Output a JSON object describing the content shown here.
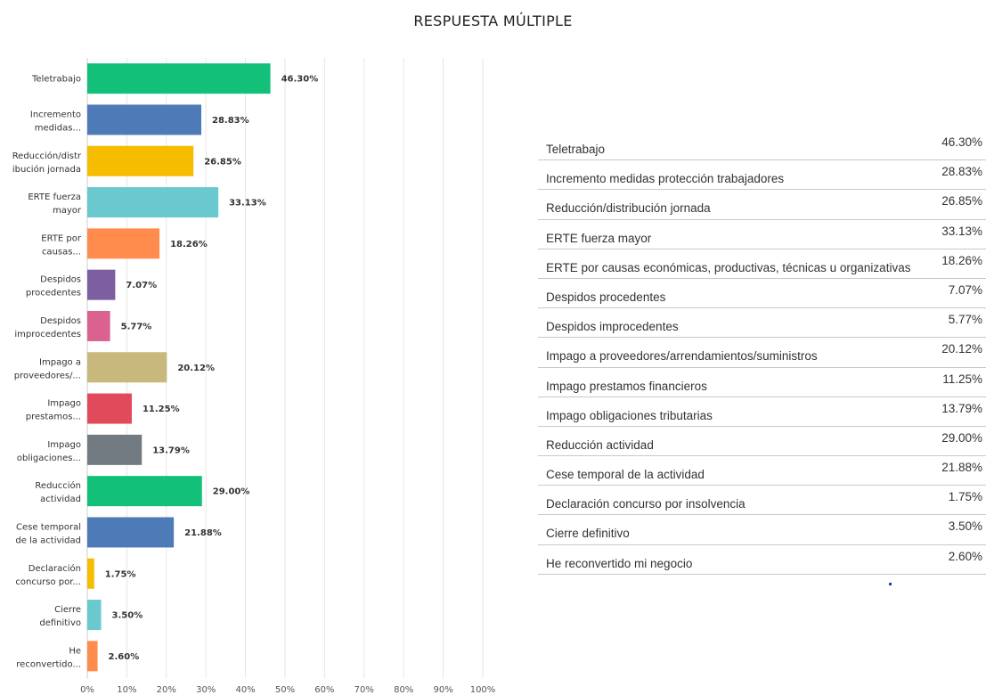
{
  "title": "RESPUESTA MÚLTIPLE",
  "chart_data": {
    "type": "bar",
    "orientation": "horizontal",
    "title": "RESPUESTA MÚLTIPLE",
    "xlim": [
      0,
      100
    ],
    "x_ticks": [
      "0%",
      "10%",
      "20%",
      "30%",
      "40%",
      "50%",
      "60%",
      "70%",
      "80%",
      "90%",
      "100%"
    ],
    "grid": true,
    "categories": [
      [
        "Teletrabajo"
      ],
      [
        "Incremento",
        "medidas..."
      ],
      [
        "Reducción/distr",
        "ibución jornada"
      ],
      [
        "ERTE fuerza",
        "mayor"
      ],
      [
        "ERTE por",
        "causas..."
      ],
      [
        "Despidos",
        "procedentes"
      ],
      [
        "Despidos",
        "improcedentes"
      ],
      [
        "Impago a",
        "proveedores/..."
      ],
      [
        "Impago",
        "prestamos..."
      ],
      [
        "Impago",
        "obligaciones..."
      ],
      [
        "Reducción",
        "actividad"
      ],
      [
        "Cese temporal",
        "de la actividad"
      ],
      [
        "Declaración",
        "concurso por..."
      ],
      [
        "Cierre",
        "definitivo"
      ],
      [
        "He",
        "reconvertido..."
      ]
    ],
    "values": [
      46.3,
      28.83,
      26.85,
      33.13,
      18.26,
      7.07,
      5.77,
      20.12,
      11.25,
      13.79,
      29.0,
      21.88,
      1.75,
      3.5,
      2.6
    ],
    "value_labels": [
      "46.30%",
      "28.83%",
      "26.85%",
      "33.13%",
      "18.26%",
      "7.07%",
      "5.77%",
      "20.12%",
      "11.25%",
      "13.79%",
      "29.00%",
      "21.88%",
      "1.75%",
      "3.50%",
      "2.60%"
    ],
    "colors": [
      "#12c07a",
      "#4f7ab8",
      "#f5bc00",
      "#6ac9cf",
      "#ff8c4d",
      "#7d5ea0",
      "#d9628f",
      "#c9b87c",
      "#e04a5a",
      "#737b82",
      "#12c07a",
      "#4f7ab8",
      "#f5bc00",
      "#6ac9cf",
      "#ff8c4d"
    ]
  },
  "table": {
    "rows": [
      {
        "label": "Teletrabajo",
        "value": "46.30%"
      },
      {
        "label": "Incremento medidas protección trabajadores",
        "value": "28.83%"
      },
      {
        "label": "Reducción/distribución jornada",
        "value": "26.85%"
      },
      {
        "label": "ERTE fuerza mayor",
        "value": "33.13%"
      },
      {
        "label": "ERTE por causas económicas, productivas, técnicas u organizativas",
        "value": "18.26%"
      },
      {
        "label": "Despidos procedentes",
        "value": "7.07%"
      },
      {
        "label": "Despidos improcedentes",
        "value": "5.77%"
      },
      {
        "label": "Impago a proveedores/arrendamientos/suministros",
        "value": "20.12%"
      },
      {
        "label": "Impago prestamos financieros",
        "value": "11.25%"
      },
      {
        "label": "Impago obligaciones tributarias",
        "value": "13.79%"
      },
      {
        "label": "Reducción actividad",
        "value": "29.00%"
      },
      {
        "label": "Cese temporal de la actividad",
        "value": "21.88%"
      },
      {
        "label": "Declaración concurso por insolvencia",
        "value": "1.75%"
      },
      {
        "label": "Cierre definitivo",
        "value": "3.50%"
      },
      {
        "label": "He reconvertido mi negocio",
        "value": "2.60%"
      }
    ]
  }
}
